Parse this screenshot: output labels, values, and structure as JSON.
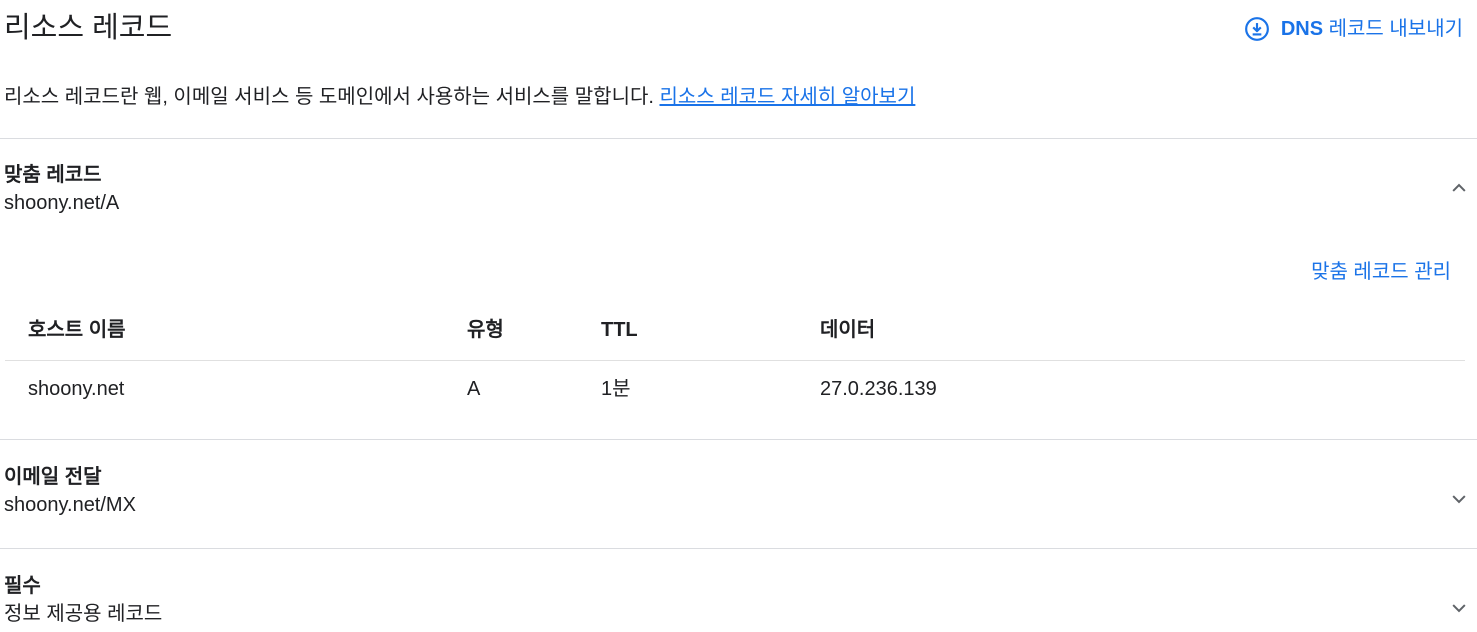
{
  "header": {
    "title": "리소스 레코드",
    "export_prefix": "DNS",
    "export_suffix": " 레코드 내보내기",
    "export_icon": "download-circle-icon"
  },
  "description": {
    "text": "리소스 레코드란 웹, 이메일 서비스 등 도메인에서 사용하는 서비스를 말합니다. ",
    "link_text": "리소스 레코드 자세히 알아보기"
  },
  "sections": [
    {
      "title": "맞춤 레코드",
      "subtitle": "shoony.net/A",
      "expanded": true,
      "toggle_icon": "chevron-up-icon",
      "manage_label": "맞춤 레코드 관리",
      "columns": [
        "호스트 이름",
        "유형",
        "TTL",
        "데이터"
      ],
      "rows": [
        {
          "host": "shoony.net",
          "type": "A",
          "ttl": "1분",
          "data": "27.0.236.139"
        }
      ]
    },
    {
      "title": "이메일 전달",
      "subtitle": "shoony.net/MX",
      "expanded": false,
      "toggle_icon": "chevron-down-icon"
    },
    {
      "title": "필수",
      "subtitle": "정보 제공용 레코드",
      "expanded": false,
      "toggle_icon": "chevron-down-icon"
    }
  ],
  "colors": {
    "accent": "#1a73e8",
    "text": "#202124",
    "divider": "#dadce0"
  }
}
